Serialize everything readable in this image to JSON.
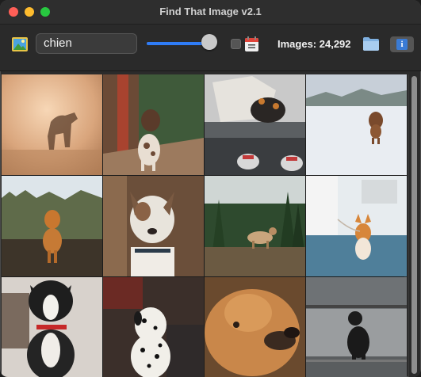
{
  "window": {
    "title": "Find That Image v2.1"
  },
  "toolbar": {
    "search_value": "chien",
    "slider_value": 0.9,
    "checkbox_checked": false,
    "image_count_label": "Images: 24,292",
    "icons": [
      "picture-icon",
      "calendar-icon",
      "folder-icon",
      "info-icon"
    ],
    "info_glyph": "i"
  },
  "colors": {
    "accent": "#2f7cf6",
    "background": "#2b2b2b"
  },
  "grid": {
    "columns": 4,
    "rows": 3,
    "images": [
      {
        "subject": "dog silhouette in golden field"
      },
      {
        "subject": "spotted pointer dog on porch"
      },
      {
        "subject": "dog lying on blanket with sneakers"
      },
      {
        "subject": "dog running on snow"
      },
      {
        "subject": "golden retriever on moor"
      },
      {
        "subject": "dog portrait close-up"
      },
      {
        "subject": "dog in forest clearing"
      },
      {
        "subject": "corgi on leash on rooftop"
      },
      {
        "subject": "french bulldog with red collar"
      },
      {
        "subject": "dalmatian puppy"
      },
      {
        "subject": "fluffy dog close-up"
      },
      {
        "subject": "black dog sitting on step"
      }
    ]
  }
}
